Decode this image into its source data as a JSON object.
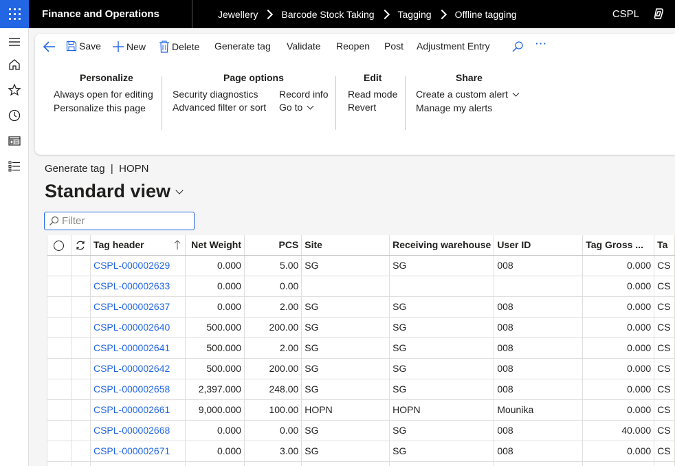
{
  "topbar": {
    "app_title": "Finance and Operations",
    "breadcrumbs": [
      "Jewellery",
      "Barcode Stock Taking",
      "Tagging",
      "Offline tagging"
    ],
    "company": "CSPL"
  },
  "toolbar": {
    "save_label": "Save",
    "new_label": "New",
    "delete_label": "Delete",
    "generate_tag_label": "Generate tag",
    "validate_label": "Validate",
    "reopen_label": "Reopen",
    "post_label": "Post",
    "adjustment_entry_label": "Adjustment Entry",
    "more_label": "···"
  },
  "groups": {
    "personalize": {
      "title": "Personalize",
      "items": [
        "Always open for editing",
        "Personalize this page"
      ]
    },
    "page_options": {
      "title": "Page options",
      "items": [
        "Security diagnostics",
        "Advanced filter or sort",
        "Record info",
        "Go to"
      ]
    },
    "edit": {
      "title": "Edit",
      "items": [
        "Read mode",
        "Revert"
      ]
    },
    "share": {
      "title": "Share",
      "items": [
        "Create a custom alert",
        "Manage my alerts"
      ]
    }
  },
  "page": {
    "breadcrumb": "Generate tag  |  HOPN",
    "view_title": "Standard view",
    "filter_placeholder": "Filter"
  },
  "grid": {
    "columns": [
      "Tag header",
      "Net Weight",
      "PCS",
      "Site",
      "Receiving warehouse",
      "User ID",
      "Tag Gross ...",
      "Ta"
    ],
    "rows": [
      [
        "CSPL-000002629",
        "0.000",
        "5.00",
        "SG",
        "SG",
        "008",
        "0.000",
        "CS"
      ],
      [
        "CSPL-000002633",
        "0.000",
        "0.00",
        "",
        "",
        "",
        "0.000",
        "CS"
      ],
      [
        "CSPL-000002637",
        "0.000",
        "2.00",
        "SG",
        "SG",
        "008",
        "0.000",
        "CS"
      ],
      [
        "CSPL-000002640",
        "500.000",
        "200.00",
        "SG",
        "SG",
        "008",
        "0.000",
        "CS"
      ],
      [
        "CSPL-000002641",
        "500.000",
        "2.00",
        "SG",
        "SG",
        "008",
        "0.000",
        "CS"
      ],
      [
        "CSPL-000002642",
        "500.000",
        "200.00",
        "SG",
        "SG",
        "008",
        "0.000",
        "CS"
      ],
      [
        "CSPL-000002658",
        "2,397.000",
        "248.00",
        "SG",
        "SG",
        "008",
        "0.000",
        "CS"
      ],
      [
        "CSPL-000002661",
        "9,000.000",
        "100.00",
        "HOPN",
        "HOPN",
        "Mounika",
        "0.000",
        "CS"
      ],
      [
        "CSPL-000002668",
        "0.000",
        "0.00",
        "SG",
        "SG",
        "008",
        "40.000",
        "CS"
      ],
      [
        "CSPL-000002671",
        "0.000",
        "3.00",
        "SG",
        "SG",
        "008",
        "0.000",
        "CS"
      ],
      [
        "",
        "",
        "",
        "",
        "",
        "",
        "",
        ""
      ]
    ]
  },
  "colors": {
    "accent": "#2266e3",
    "topbar_bg": "#000000",
    "link": "#2266e3"
  }
}
